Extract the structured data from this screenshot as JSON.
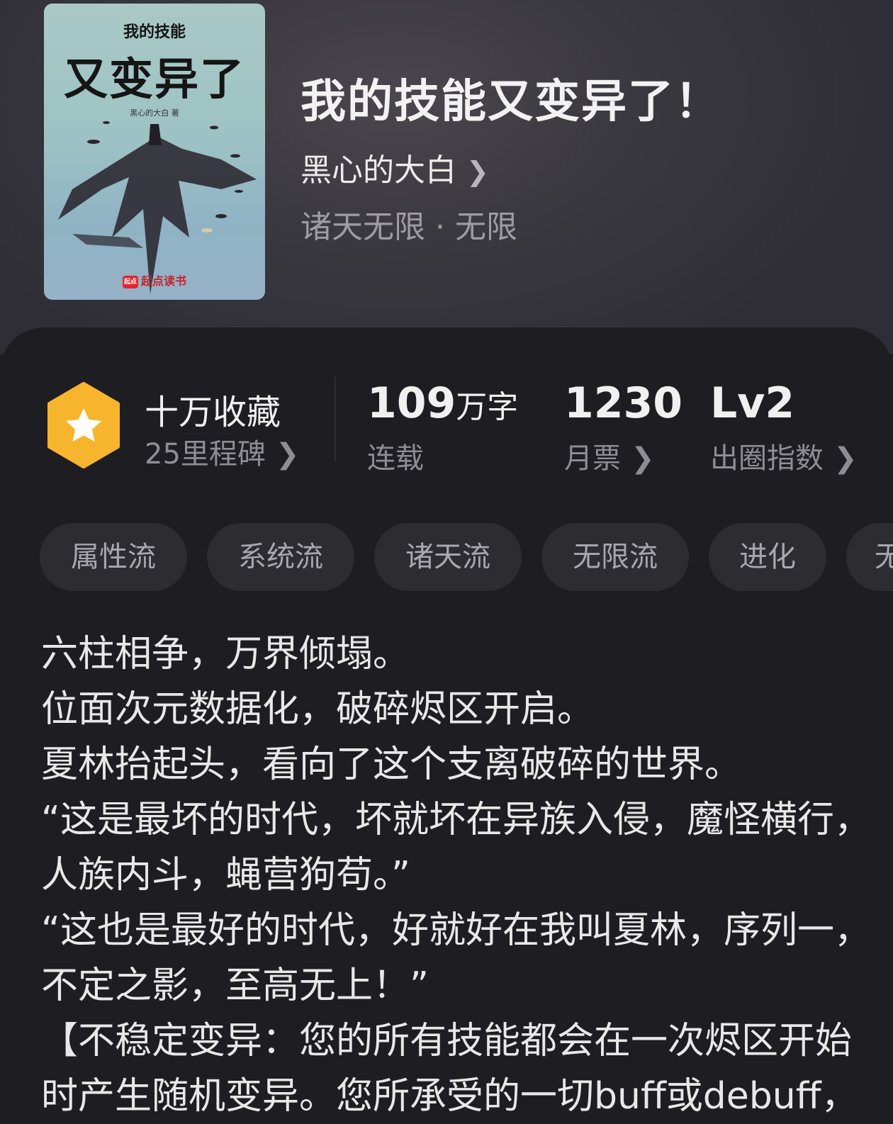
{
  "cover": {
    "title_small": "我的技能",
    "title_big": "又变异了",
    "author": "黑心的大白 著",
    "logo_mark": "起点",
    "logo_text": "起点读书"
  },
  "book": {
    "title": "我的技能又变异了！",
    "author": "黑心的大白",
    "genre": "诸天无限 · 无限"
  },
  "stats": {
    "favorites": {
      "main": "十万收藏",
      "sub": "25里程碑"
    },
    "words": {
      "number": "109",
      "unit": "万字",
      "sub": "连载"
    },
    "tickets": {
      "number": "1230",
      "sub": "月票"
    },
    "level": {
      "value": "Lv2",
      "sub": "出圈指数"
    }
  },
  "tags": [
    "属性流",
    "系统流",
    "诸天流",
    "无限流",
    "进化",
    "无"
  ],
  "description": [
    "六柱相争，万界倾塌。",
    "位面次元数据化，破碎烬区开启。",
    "夏林抬起头，看向了这个支离破碎的世界。",
    "“这是最坏的时代，坏就坏在异族入侵，魔怪横行，",
    "人族内斗，蝇营狗苟。”",
    "“这也是最好的时代，好就好在我叫夏林，序列一，",
    "不定之影，至高无上！”",
    "【不稳定变异：您的所有技能都会在一次烬区开始",
    "时产生随机变异。您所承受的一切buff或debuff，"
  ],
  "colors": {
    "badge": "#f7b52d",
    "background": "#1e1d21",
    "tag_bg": "#2d2c31"
  }
}
